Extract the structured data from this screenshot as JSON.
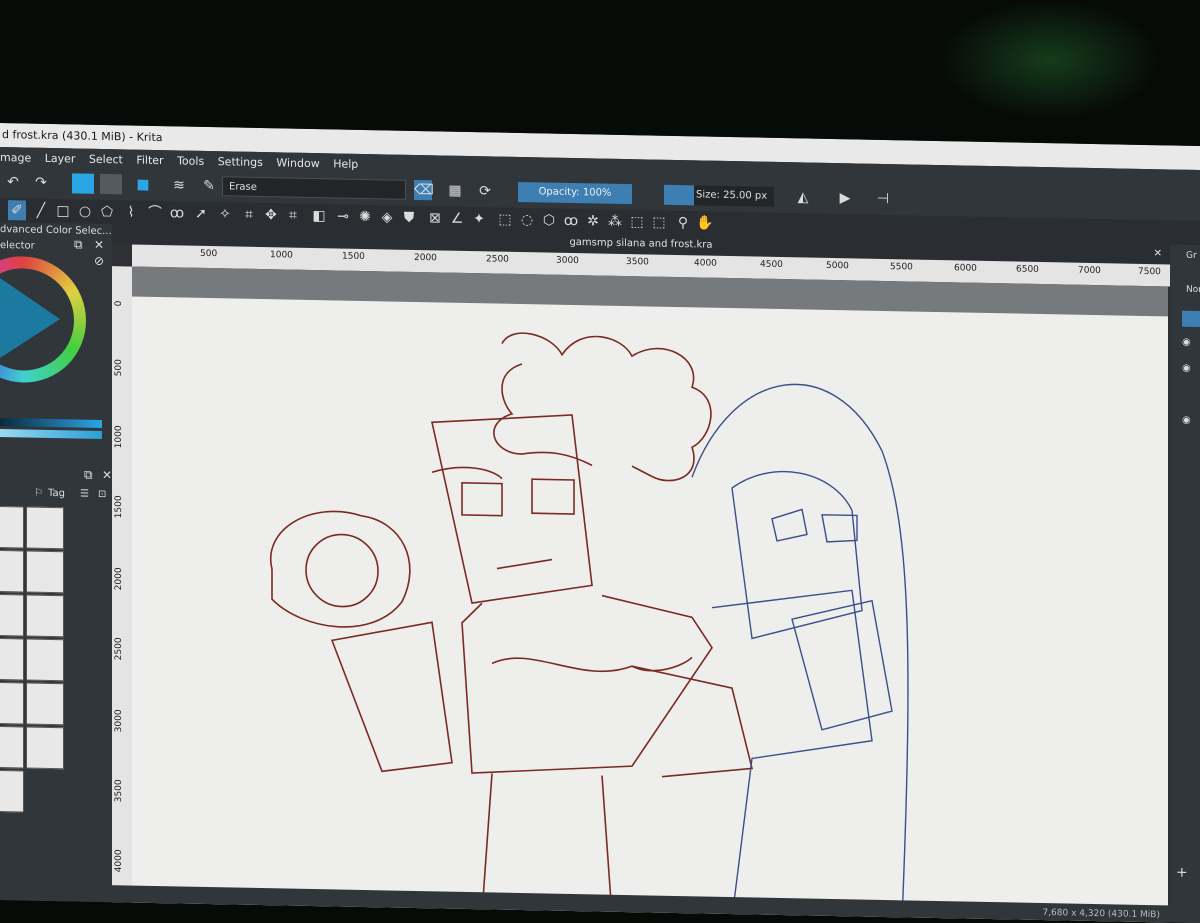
{
  "window": {
    "title": "d frost.kra (430.1 MiB)  - Krita"
  },
  "menu": {
    "items": [
      "mage",
      "Layer",
      "Select",
      "Filter",
      "Tools",
      "Settings",
      "Window",
      "Help"
    ]
  },
  "toolbar": {
    "brush_preset": "Erase",
    "opacity_label": "Opacity: 100%",
    "opacity_value": 1.0,
    "size_label": "Size: 25.00 px"
  },
  "dockers": {
    "advanced_color_selector": "dvanced Color Selec...",
    "color_selector": "elector",
    "brush_tag": "Tag"
  },
  "document": {
    "tab_title": "gamsmp silana and frost.kra",
    "ruler_h": [
      "500",
      "1000",
      "1500",
      "2000",
      "2500",
      "3000",
      "3500",
      "4000",
      "4500",
      "5000",
      "5500",
      "6000",
      "6500",
      "7000",
      "7500"
    ],
    "ruler_v": [
      "0",
      "500",
      "1000",
      "1500",
      "2000",
      "2500",
      "3000",
      "3500",
      "4000"
    ]
  },
  "right_panel": {
    "labels": [
      "Gr",
      "Nor"
    ]
  },
  "status": {
    "text": "7,680 x 4,320 (430.1 MiB)"
  },
  "colors": {
    "accent": "#3d7fb3",
    "sketch_red": "#7a2b22",
    "sketch_blue": "#3b4f8a",
    "paper": "#eeeeec"
  }
}
